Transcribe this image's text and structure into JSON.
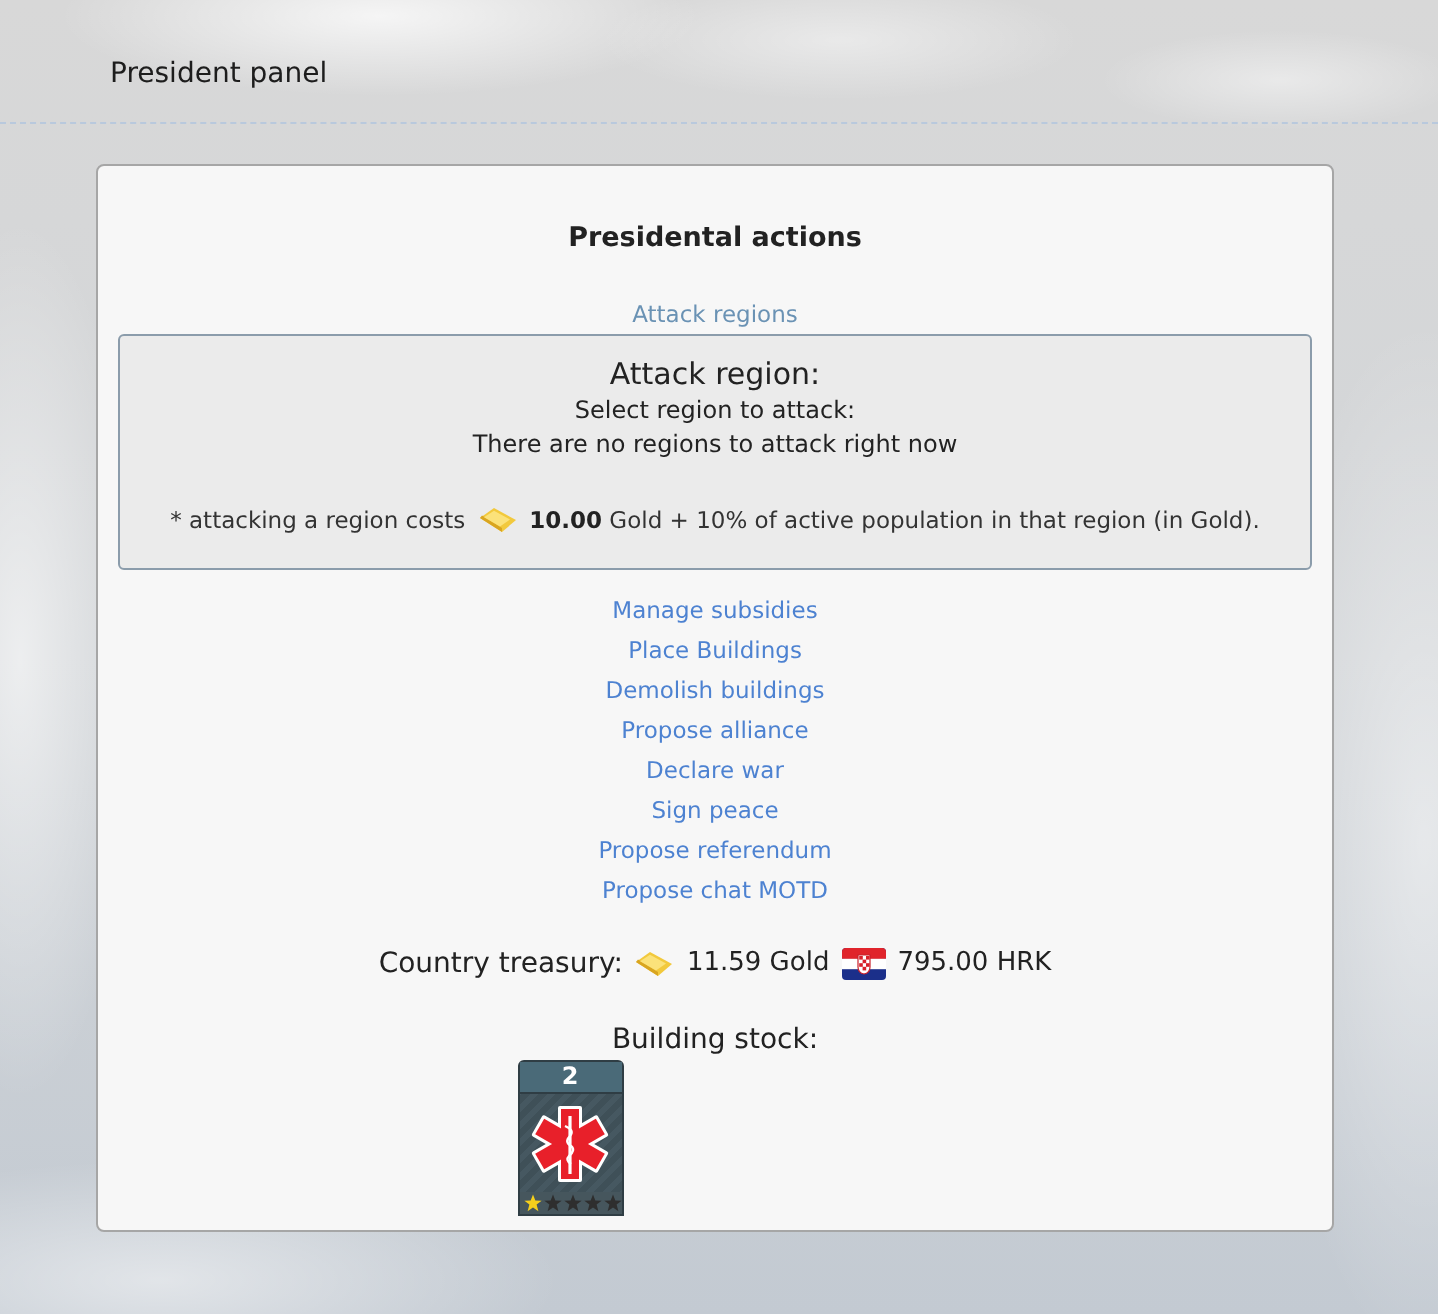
{
  "header": {
    "title": "President panel"
  },
  "panel": {
    "title": "Presidental actions",
    "actions": [
      {
        "label": "Attack regions",
        "expanded": true,
        "details": {
          "heading": "Attack region:",
          "prompt": "Select region to attack:",
          "message": "There are no regions to attack right now",
          "note_before": "* attacking a region costs",
          "note_after": "**10.00** Gold + 10% of active population in that region (in Gold)."
        }
      },
      {
        "label": "Manage subsidies",
        "expanded": false
      },
      {
        "label": "Place Buildings",
        "expanded": false
      },
      {
        "label": "Demolish buildings",
        "expanded": false
      },
      {
        "label": "Propose alliance",
        "expanded": false
      },
      {
        "label": "Declare war",
        "expanded": false
      },
      {
        "label": "Sign peace",
        "expanded": false
      },
      {
        "label": "Propose referendum",
        "expanded": false
      },
      {
        "label": "Propose chat MOTD",
        "expanded": false
      }
    ],
    "treasury": {
      "label": "Country treasury:",
      "gold": "11.59 Gold",
      "local": "795.00 HRK"
    },
    "stock": {
      "label": "Building stock:",
      "buildings": [
        {
          "count": "2",
          "stars": 1
        }
      ]
    }
  }
}
